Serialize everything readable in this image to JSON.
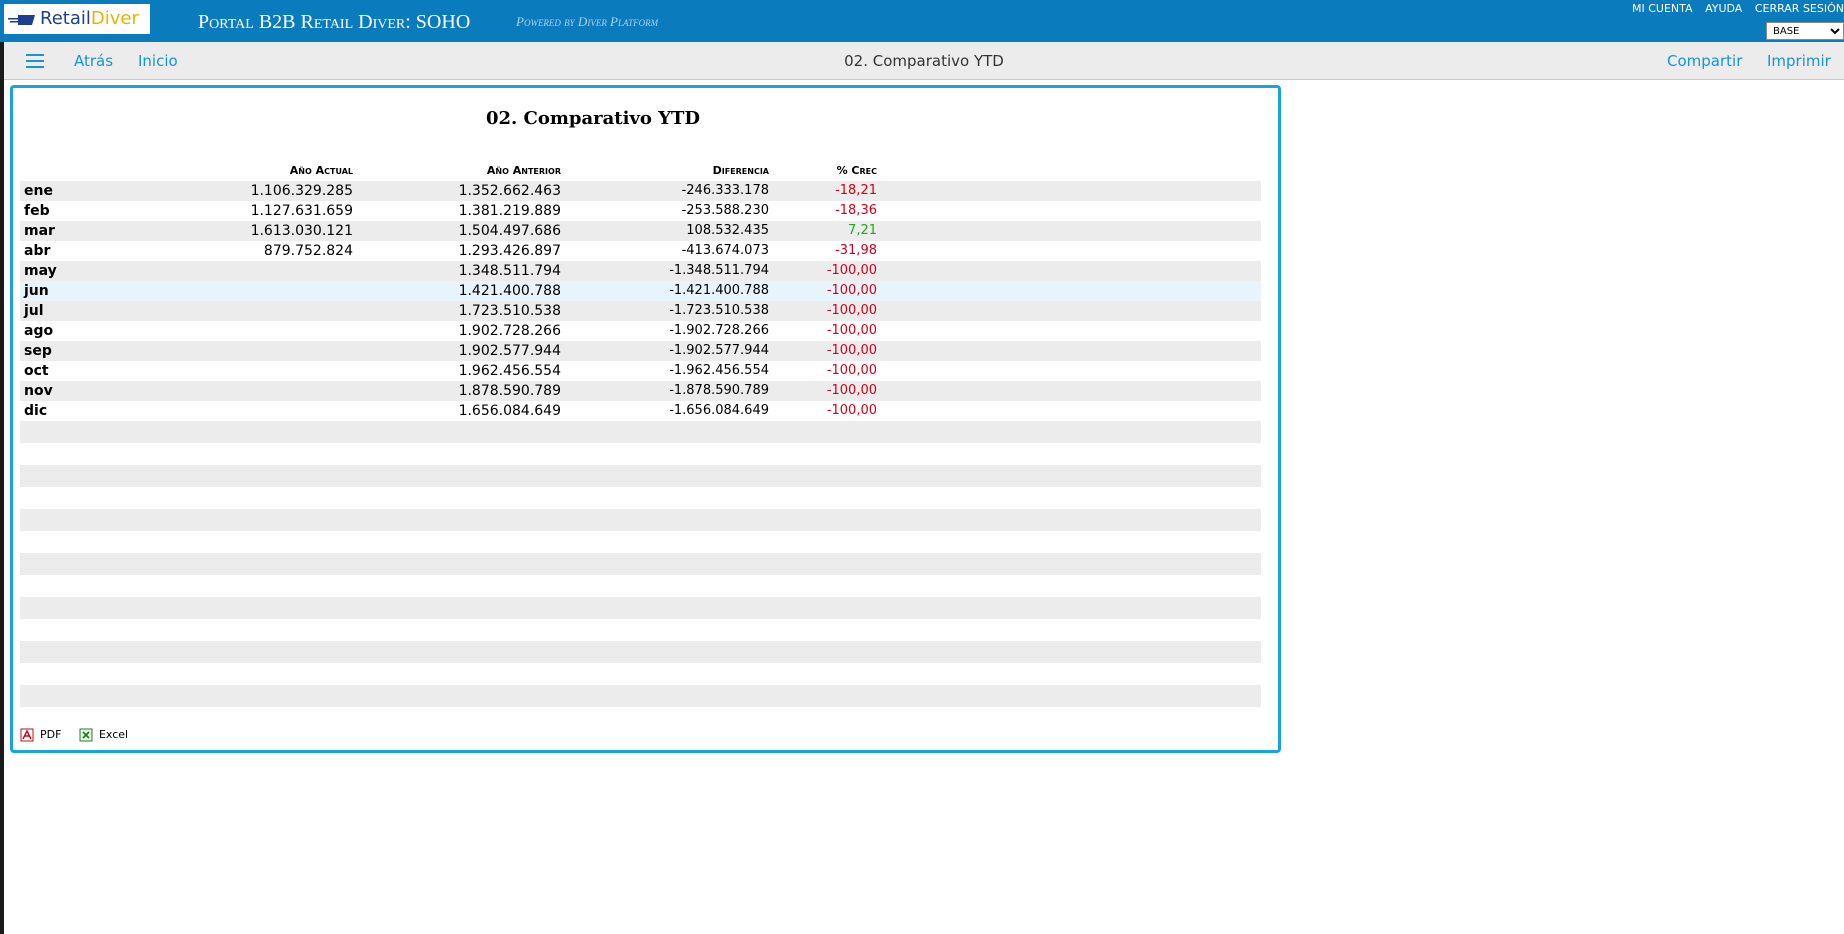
{
  "header": {
    "logo": {
      "part1": "Retail",
      "part2": "Diver"
    },
    "portal_title": "Portal B2B Retail Diver: SOHO",
    "powered_by": "Powered by Diver Platform",
    "links": [
      "MI CUENTA",
      "AYUDA",
      "CERRAR SESIÓN"
    ],
    "base_select": "BASE"
  },
  "toolbar": {
    "back": "Atrás",
    "home": "Inicio",
    "title": "02. Comparativo YTD",
    "share": "Compartir",
    "print": "Imprimir"
  },
  "report": {
    "title": "02. Comparativo YTD",
    "columns": [
      "Año Actual",
      "Año Anterior",
      "Diferencia",
      "% Crec"
    ],
    "rows": [
      {
        "month": "ene",
        "actual": "1.106.329.285",
        "anterior": "1.352.662.463",
        "diferencia": "-246.333.178",
        "crec": "-18,21",
        "crec_color": "#d0021b"
      },
      {
        "month": "feb",
        "actual": "1.127.631.659",
        "anterior": "1.381.219.889",
        "diferencia": "-253.588.230",
        "crec": "-18,36",
        "crec_color": "#d0021b"
      },
      {
        "month": "mar",
        "actual": "1.613.030.121",
        "anterior": "1.504.497.686",
        "diferencia": "108.532.435",
        "crec": "7,21",
        "crec_color": "#1da81d"
      },
      {
        "month": "abr",
        "actual": "879.752.824",
        "anterior": "1.293.426.897",
        "diferencia": "-413.674.073",
        "crec": "-31,98",
        "crec_color": "#d0021b"
      },
      {
        "month": "may",
        "actual": "",
        "anterior": "1.348.511.794",
        "diferencia": "-1.348.511.794",
        "crec": "-100,00",
        "crec_color": "#d0021b"
      },
      {
        "month": "jun",
        "actual": "",
        "anterior": "1.421.400.788",
        "diferencia": "-1.421.400.788",
        "crec": "-100,00",
        "crec_color": "#d0021b"
      },
      {
        "month": "jul",
        "actual": "",
        "anterior": "1.723.510.538",
        "diferencia": "-1.723.510.538",
        "crec": "-100,00",
        "crec_color": "#d0021b"
      },
      {
        "month": "ago",
        "actual": "",
        "anterior": "1.902.728.266",
        "diferencia": "-1.902.728.266",
        "crec": "-100,00",
        "crec_color": "#d0021b"
      },
      {
        "month": "sep",
        "actual": "",
        "anterior": "1.902.577.944",
        "diferencia": "-1.902.577.944",
        "crec": "-100,00",
        "crec_color": "#d0021b"
      },
      {
        "month": "oct",
        "actual": "",
        "anterior": "1.962.456.554",
        "diferencia": "-1.962.456.554",
        "crec": "-100,00",
        "crec_color": "#d0021b"
      },
      {
        "month": "nov",
        "actual": "",
        "anterior": "1.878.590.789",
        "diferencia": "-1.878.590.789",
        "crec": "-100,00",
        "crec_color": "#d0021b"
      },
      {
        "month": "dic",
        "actual": "",
        "anterior": "1.656.084.649",
        "diferencia": "-1.656.084.649",
        "crec": "-100,00",
        "crec_color": "#d0021b"
      }
    ]
  },
  "exports": {
    "pdf": "PDF",
    "excel": "Excel"
  },
  "icons": [
    "menu-icon",
    "pdf-icon",
    "excel-icon"
  ],
  "colors": {
    "header": "#0a7bbd",
    "accent": "#1795d2",
    "negative": "#d0021b",
    "positive": "#1da81d"
  }
}
